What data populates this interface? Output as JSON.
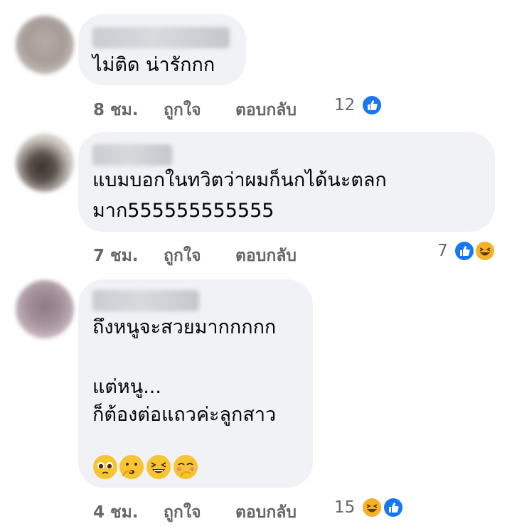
{
  "comments": [
    {
      "text_lines": [
        "ไม่ติด น่ารักกก"
      ],
      "time": "8 ชม.",
      "like_label": "ถูกใจ",
      "reply_label": "ตอบกลับ",
      "reaction_count": "12",
      "reactions": [
        "like-icon"
      ]
    },
    {
      "text_lines": [
        "แบมบอกในทวิตว่าผมก็นกได้นะตลก",
        "มาก555555555555"
      ],
      "time": "7 ชม.",
      "like_label": "ถูกใจ",
      "reply_label": "ตอบกลับ",
      "reaction_count": "7",
      "reactions": [
        "like-icon",
        "haha-icon"
      ]
    },
    {
      "text_lines": [
        "ถึงหนูจะสวยมากกกกก",
        "",
        "แต่หนู...",
        "ก็ต้องต่อแถวค่ะลูกสาว"
      ],
      "emojis": [
        "pleading-face-icon",
        "hand-over-mouth-icon",
        "laughing-face-icon",
        "giggle-face-icon"
      ],
      "time": "4 ชม.",
      "like_label": "ถูกใจ",
      "reply_label": "ตอบกลับ",
      "reaction_count": "15",
      "reactions": [
        "haha-icon",
        "like-icon"
      ]
    }
  ],
  "colors": {
    "bubble": "#f0f2f5",
    "meta": "#65676b",
    "like": "#1877f2",
    "haha": "#f7b125"
  }
}
